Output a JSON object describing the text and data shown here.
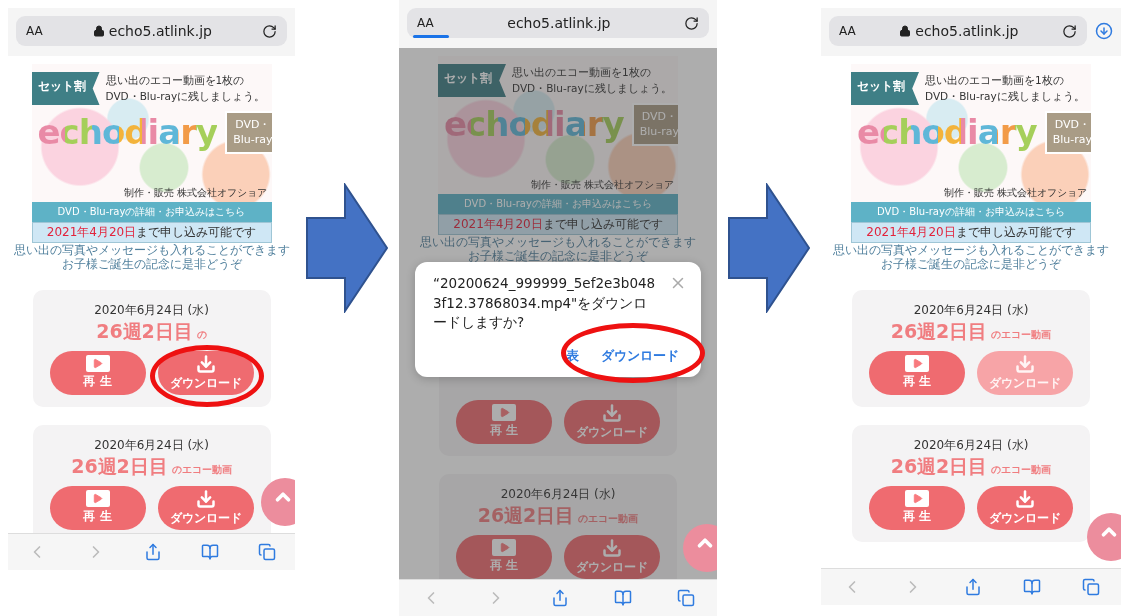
{
  "phones": [
    {
      "address_bar": {
        "text_size": "AA",
        "url": "echo5.atlink.jp",
        "secure": true,
        "loading": false,
        "download_indicator": false
      },
      "dimmed": false,
      "banner": {
        "tag": "セット割",
        "headline": "思い出のエコー動画を1枚の",
        "headline_2": "DVD・Blu-rayに残しましょう。",
        "logo": "echodiary",
        "badge": "DVD・",
        "badge_2": "Blu-ray",
        "credit": "制作・販売 株式会社オフショア",
        "link": "DVD・Blu-rayの詳細・お申込みはこちら",
        "deadline": "**2021年4月20日**まで申し込み可能です",
        "note": "思い出の写真やメッセージも入れることができます",
        "note_2": "お子様ご誕生の記念に是非どうぞ"
      },
      "cards": [
        {
          "date": "2020年6月24日 (水)",
          "week": "26週2日目",
          "suffix": "の",
          "buttons": [
            {
              "kind": "play",
              "label": "再 生",
              "disabled": false,
              "highlighted": false
            },
            {
              "kind": "download",
              "label": "ダウンロード",
              "disabled": false,
              "highlighted": true
            }
          ]
        },
        {
          "date": "2020年6月24日 (水)",
          "week": "26週2日目",
          "suffix": "のエコー動画",
          "buttons": [
            {
              "kind": "play",
              "label": "再 生",
              "disabled": false,
              "highlighted": false
            },
            {
              "kind": "download",
              "label": "ダウンロード",
              "disabled": false,
              "highlighted": false
            }
          ]
        }
      ]
    },
    {
      "address_bar": {
        "text_size": "AA",
        "url": "echo5.atlink.jp",
        "secure": false,
        "loading": true,
        "download_indicator": false
      },
      "dimmed": true,
      "banner": {
        "tag": "セット割",
        "headline": "思い出のエコー動画を1枚の",
        "headline_2": "DVD・Blu-rayに残しましょう。",
        "logo": "echodiary",
        "badge": "DVD・",
        "badge_2": "Blu-ray",
        "credit": "制作・販売 株式会社オフショア",
        "link": "DVD・Blu-rayの詳細・お申込みはこちら",
        "deadline": "**2021年4月20日**まで申し込み可能です",
        "note": "思い出の写真やメッセージも入れることができます",
        "note_2": "お子様ご誕生の記念に是非どうぞ"
      },
      "cards": [
        {
          "buttons": [
            {
              "kind": "play",
              "label": "再 生",
              "disabled": false,
              "highlighted": false
            },
            {
              "kind": "download",
              "label": "ダウンロード",
              "disabled": false,
              "highlighted": false
            }
          ]
        },
        {
          "date": "2020年6月24日 (水)",
          "week": "26週2日目",
          "suffix": "のエコー動画",
          "buttons": [
            {
              "kind": "play",
              "label": "再 生",
              "disabled": false,
              "highlighted": false
            },
            {
              "kind": "download",
              "label": "ダウンロード",
              "disabled": false,
              "highlighted": false
            }
          ]
        }
      ],
      "dialog": {
        "message": "“20200624_999999_5ef2e3b0483f12.37868034.mp4\"をダウンロードしますか?",
        "buttons": [
          {
            "label": "表",
            "highlighted": false
          },
          {
            "label": "ダウンロード",
            "highlighted": true
          }
        ]
      }
    },
    {
      "address_bar": {
        "text_size": "AA",
        "url": "echo5.atlink.jp",
        "secure": true,
        "loading": false,
        "download_indicator": true
      },
      "dimmed": false,
      "banner": {
        "tag": "セット割",
        "headline": "思い出のエコー動画を1枚の",
        "headline_2": "DVD・Blu-rayに残しましょう。",
        "logo": "echodiary",
        "badge": "DVD・",
        "badge_2": "Blu-ray",
        "credit": "制作・販売 株式会社オフショア",
        "link": "DVD・Blu-rayの詳細・お申込みはこちら",
        "deadline": "**2021年4月20日**まで申し込み可能です",
        "note": "思い出の写真やメッセージも入れることができます",
        "note_2": "お子様ご誕生の記念に是非どうぞ"
      },
      "cards": [
        {
          "date": "2020年6月24日 (水)",
          "week": "26週2日目",
          "suffix": "のエコー動画",
          "buttons": [
            {
              "kind": "play",
              "label": "再 生",
              "disabled": false,
              "highlighted": false
            },
            {
              "kind": "download",
              "label": "ダウンロード",
              "disabled": true,
              "highlighted": false
            }
          ]
        },
        {
          "date": "2020年6月24日 (水)",
          "week": "26週2日目",
          "suffix": "のエコー動画",
          "buttons": [
            {
              "kind": "play",
              "label": "再 生",
              "disabled": false,
              "highlighted": false
            },
            {
              "kind": "download",
              "label": "ダウンロード",
              "disabled": false,
              "highlighted": false
            }
          ]
        }
      ]
    }
  ]
}
